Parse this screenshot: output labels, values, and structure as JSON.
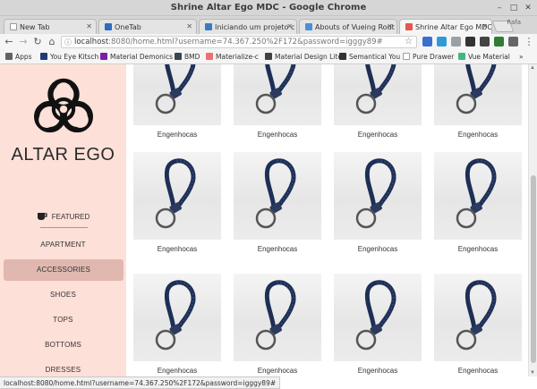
{
  "window": {
    "title": "Shrine Altar Ego MDC - Google Chrome",
    "minimize": "–",
    "maximize": "□",
    "close": "✕"
  },
  "tabs": [
    {
      "label": "New Tab",
      "icon": "blank-page-icon",
      "color": "#e4e4e4",
      "active": false
    },
    {
      "label": "OneTab",
      "icon": "onetab-icon",
      "color": "#2b6cc4",
      "active": false
    },
    {
      "label": "Iniciando um projeto c",
      "icon": "cube-icon",
      "color": "#3b7bbf",
      "active": false
    },
    {
      "label": "Abouts of Vueing Rout",
      "icon": "vue-icon",
      "color": "#4a90d9",
      "active": false
    },
    {
      "label": "Shrine Altar Ego MDC",
      "icon": "shrine-icon",
      "color": "#e8554e",
      "active": true
    }
  ],
  "profile_label": "Rafa",
  "toolbar": {
    "back": "←",
    "forward": "→",
    "reload": "↻",
    "home": "⌂",
    "url_host": "localhost",
    "url_rest": ":8080/home.html?username=74.367.250%2F172&password=igggy89#",
    "star": "☆"
  },
  "bookmarks": [
    {
      "label": "Apps",
      "icon": "apps-grid-icon",
      "color": "#5f6368"
    },
    {
      "label": "You Eye Kitsch",
      "icon": "kitsch-icon",
      "color": "#1f3b73"
    },
    {
      "label": "Material Demonics",
      "icon": "material-icon",
      "color": "#7b1fa2"
    },
    {
      "label": "BMD",
      "icon": "b-icon",
      "color": "#37474f"
    },
    {
      "label": "Materialize-c",
      "icon": "materialize-icon",
      "color": "#ee6e73"
    },
    {
      "label": "Material Design Lite",
      "icon": "mdl-icon",
      "color": "#424242"
    },
    {
      "label": "Semantical You",
      "icon": "s-icon",
      "color": "#333333"
    },
    {
      "label": "Pure Drawer",
      "icon": "page-icon",
      "color": "#9e9e9e"
    },
    {
      "label": "Vue Material",
      "icon": "vue-material-icon",
      "color": "#41b883"
    }
  ],
  "bookmarks_overflow": "»",
  "sidebar": {
    "brand": "ALTAR EGO",
    "featured": "FEATURED",
    "items": [
      "APARTMENT",
      "ACCESSORIES",
      "SHOES",
      "TOPS",
      "BOTTOMS",
      "DRESSES"
    ],
    "selected": "ACCESSORIES",
    "accent": "#e57e76",
    "background": "#fde0d8"
  },
  "products": [
    "Engenhocas",
    "Engenhocas",
    "Engenhocas",
    "Engenhocas",
    "Engenhocas",
    "Engenhocas",
    "Engenhocas",
    "Engenhocas",
    "Engenhocas",
    "Engenhocas",
    "Engenhocas",
    "Engenhocas"
  ],
  "status_url": "localhost:8080/home.html?username=74.367.250%2F172&password=igggy89#"
}
